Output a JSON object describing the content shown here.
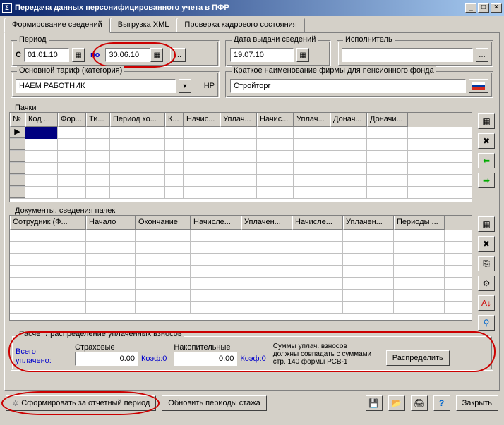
{
  "window": {
    "title": "Передача данных персонифицированного учета в ПФР",
    "icon_text": "Σ"
  },
  "tabs": {
    "t1": "Формирование сведений",
    "t2": "Выгрузка XML",
    "t3": "Проверка кадрового состояния"
  },
  "period": {
    "legend": "Период",
    "from_label": "С",
    "from": "01.01.10",
    "to_label": "по",
    "to": "30.06.10"
  },
  "issue_date": {
    "legend": "Дата выдачи сведений",
    "value": "19.07.10"
  },
  "executor": {
    "legend": "Исполнитель",
    "value": ""
  },
  "tariff": {
    "legend": "Основной тариф (категория)",
    "value": "НАЕМ РАБОТНИК",
    "code": "НР"
  },
  "firm": {
    "legend": "Краткое наименование фирмы для пенсионного фонда",
    "value": "Стройторг"
  },
  "packs": {
    "label": "Пачки",
    "cols": [
      "№",
      "Код ...",
      "Фор...",
      "Ти...",
      "Период ко...",
      "К...",
      "Начис...",
      "Уплач...",
      "Начис...",
      "Уплач...",
      "Донач...",
      "Доначи..."
    ]
  },
  "docs": {
    "label": "Документы, сведения пачек",
    "cols": [
      "Сотрудник (Ф...",
      "Начало",
      "Окончание",
      "Начисле...",
      "Уплачен...",
      "Начисле...",
      "Уплачен...",
      "Периоды ..."
    ]
  },
  "calc": {
    "legend": "Расчет / распределение уплаченных взносов",
    "total_label": "Всего уплачено:",
    "ins_label": "Страховые",
    "ins_val": "0.00",
    "ins_coef": "Коэф:0",
    "sav_label": "Накопительные",
    "sav_val": "0.00",
    "sav_coef": "Коэф:0",
    "note1": "Суммы уплач. взносов",
    "note2": "должны совпадать с суммами",
    "note3": "стр. 140 формы РСВ-1",
    "btn": "Распределить"
  },
  "footer": {
    "form_btn": "Сформировать за отчетный период",
    "refresh_btn": "Обновить периоды стажа",
    "close_btn": "Закрыть"
  }
}
